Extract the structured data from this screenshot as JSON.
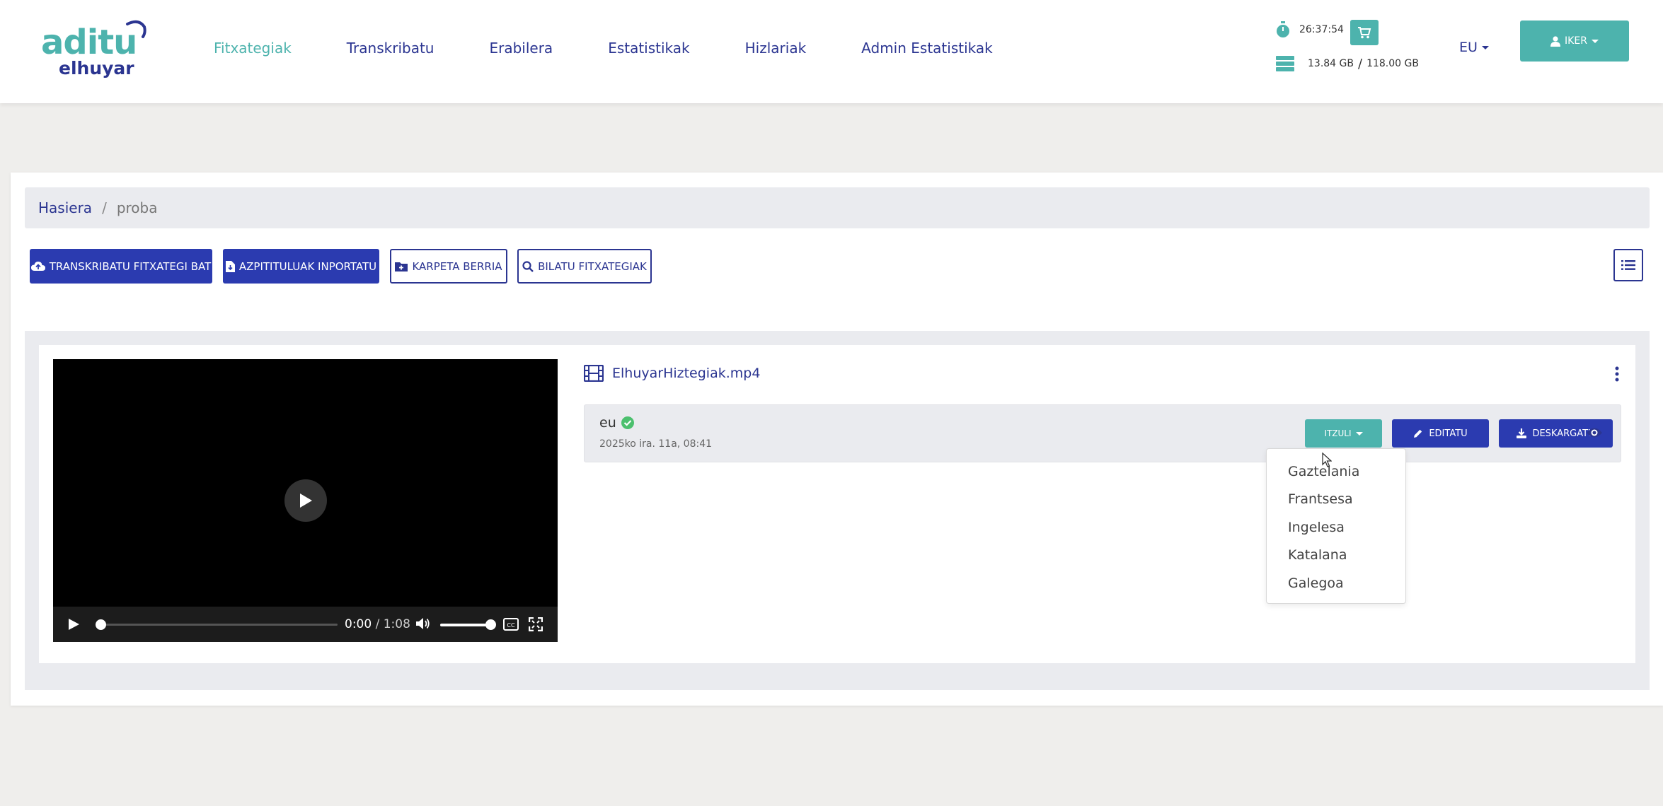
{
  "brand": {
    "name_top": "aditu",
    "name_bottom": "elhuyar"
  },
  "nav": [
    {
      "label": "Fitxategiak",
      "active": true
    },
    {
      "label": "Transkribatu",
      "active": false
    },
    {
      "label": "Erabilera",
      "active": false
    },
    {
      "label": "Estatistikak",
      "active": false
    },
    {
      "label": "Hizlariak",
      "active": false
    },
    {
      "label": "Admin Estatistikak",
      "active": false
    }
  ],
  "stats": {
    "time_remaining": "26:37:54",
    "storage_used": "13.84 GB",
    "storage_total": "118.00 GB"
  },
  "language": {
    "current": "EU"
  },
  "user": {
    "name": "IKER"
  },
  "breadcrumb": {
    "home": "Hasiera",
    "current": "proba"
  },
  "toolbar": {
    "transcribe": "TRANSKRIBATU FITXATEGI BAT",
    "import_subtitles": "AZPITITULUAK INPORTATU",
    "new_folder": "KARPETA BERRIA",
    "search_files": "BILATU FITXATEGIAK"
  },
  "file": {
    "name": "ElhuyarHiztegiak.mp4",
    "player": {
      "current_time": "0:00",
      "duration": "/ 1:08",
      "progress": 0.0,
      "volume": 1.0
    },
    "transcript": {
      "language": "eu",
      "date": "2025ko ira. 11a, 08:41",
      "translate_label": "ITZULI",
      "edit_label": "EDITATU",
      "download_label": "DESKARGATU"
    }
  },
  "translate_menu": [
    "Gaztelania",
    "Frantsesa",
    "Ingelesa",
    "Katalana",
    "Galegoa"
  ],
  "colors": {
    "primary": "#2b3bb0",
    "accent": "#4db3ad",
    "text_nav": "#2b3591"
  }
}
